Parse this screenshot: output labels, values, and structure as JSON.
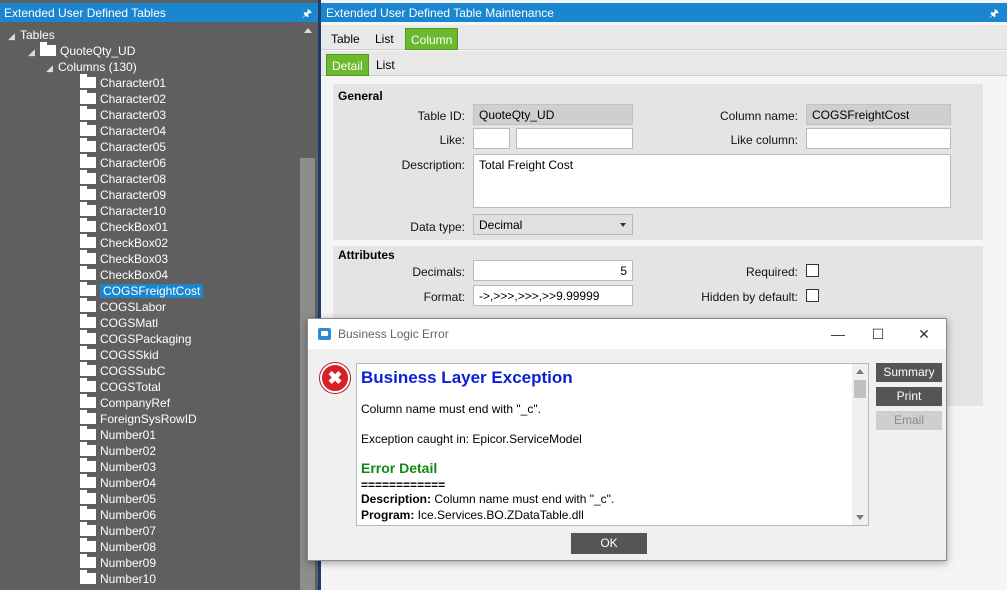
{
  "left_panel": {
    "title": "Extended User Defined Tables",
    "pin_icon": "pin-icon",
    "tree": {
      "root": "Tables",
      "table": "QuoteQty_UD",
      "columns_node": "Columns (130)",
      "columns": [
        "Character01",
        "Character02",
        "Character03",
        "Character04",
        "Character05",
        "Character06",
        "Character08",
        "Character09",
        "Character10",
        "CheckBox01",
        "CheckBox02",
        "CheckBox03",
        "CheckBox04",
        "COGSFreightCost",
        "COGSLabor",
        "COGSMatl",
        "COGSPackaging",
        "COGSSkid",
        "COGSSubC",
        "COGSTotal",
        "CompanyRef",
        "ForeignSysRowID",
        "Number01",
        "Number02",
        "Number03",
        "Number04",
        "Number05",
        "Number06",
        "Number07",
        "Number08",
        "Number09",
        "Number10"
      ],
      "selected": "COGSFreightCost"
    }
  },
  "right_panel": {
    "title": "Extended User Defined Table Maintenance",
    "top_tabs": [
      "Table",
      "List",
      "Column"
    ],
    "active_top_tab": "Column",
    "sub_tabs": [
      "Detail",
      "List"
    ],
    "active_sub_tab": "Detail",
    "general": {
      "title": "General",
      "table_id_label": "Table ID:",
      "table_id_value": "QuoteQty_UD",
      "column_name_label": "Column name:",
      "column_name_value": "COGSFreightCost",
      "like_label": "Like:",
      "like_value_1": "",
      "like_value_2": "",
      "like_column_label": "Like column:",
      "like_column_value": "",
      "description_label": "Description:",
      "description_value": "Total Freight Cost",
      "data_type_label": "Data type:",
      "data_type_value": "Decimal"
    },
    "attributes": {
      "title": "Attributes",
      "decimals_label": "Decimals:",
      "decimals_value": "5",
      "format_label": "Format:",
      "format_value": "->,>>>,>>>,>>9.99999",
      "required_label": "Required:",
      "required_checked": false,
      "hidden_label": "Hidden by default:",
      "hidden_checked": false
    }
  },
  "dialog": {
    "title": "Business Logic Error",
    "window_buttons": [
      "minimize-icon",
      "maximize-icon",
      "close-icon"
    ],
    "heading": "Business Layer Exception",
    "message": "Column name must end with \"_c\".",
    "exception_caught": "Exception caught in: Epicor.ServiceModel",
    "error_detail_title": "Error Detail",
    "separator": "============",
    "description_label": "Description:",
    "description_value": "  Column name must end with \"_c\".",
    "program_label": "Program:",
    "program_value": "  Ice.Services.BO.ZDataTable.dll",
    "buttons": {
      "summary": "Summary",
      "print": "Print",
      "email": "Email",
      "ok": "OK"
    }
  }
}
